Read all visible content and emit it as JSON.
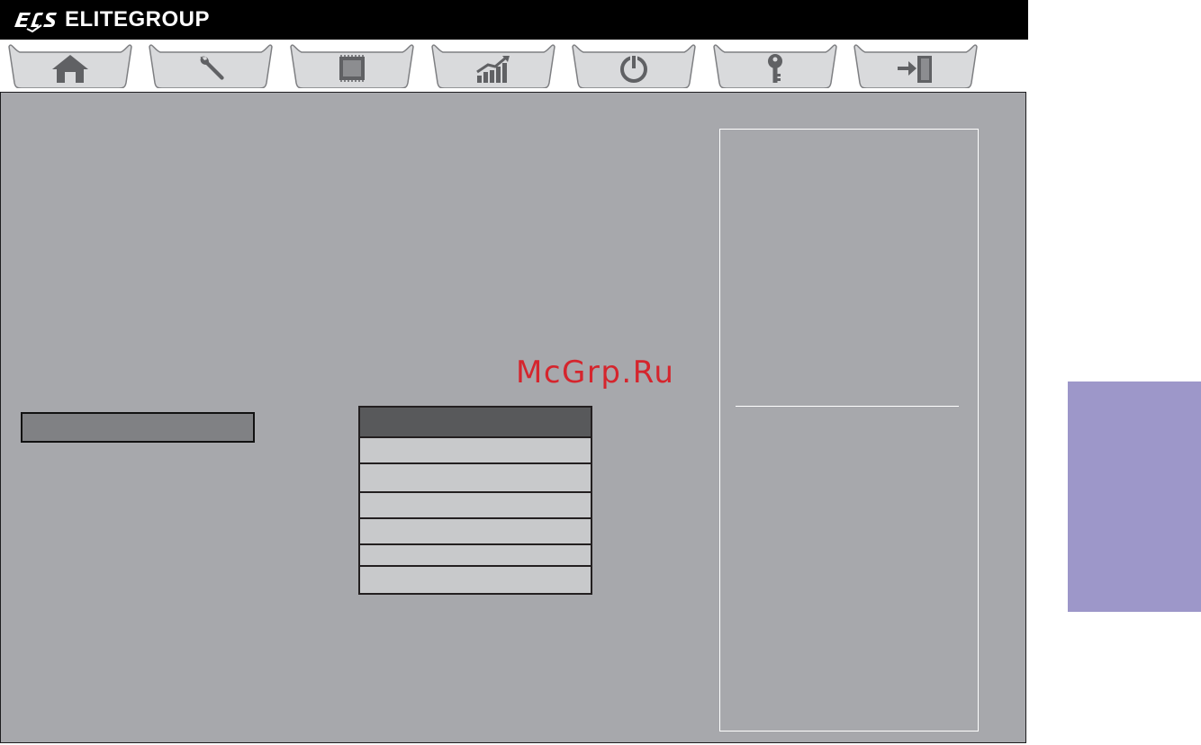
{
  "header": {
    "brand": "ELITEGROUP",
    "logo_mark": "ECS"
  },
  "tabs": [
    {
      "id": "main",
      "icon": "home-icon"
    },
    {
      "id": "advanced",
      "icon": "wrench-icon"
    },
    {
      "id": "chipset",
      "icon": "chip-icon"
    },
    {
      "id": "mib",
      "icon": "performance-chart-icon"
    },
    {
      "id": "boot",
      "icon": "power-icon"
    },
    {
      "id": "security",
      "icon": "key-icon"
    },
    {
      "id": "exit",
      "icon": "exit-door-icon"
    }
  ],
  "watermark": "McGrp.Ru",
  "dropdown": {
    "rows": 6
  },
  "colors": {
    "panel_bg": "#a7a8ac",
    "selected_item": "#808184",
    "dropdown_header": "#58595b",
    "dropdown_row": "#c8c9cb",
    "side_tab": "#9d97c9",
    "watermark": "#d5252d"
  }
}
